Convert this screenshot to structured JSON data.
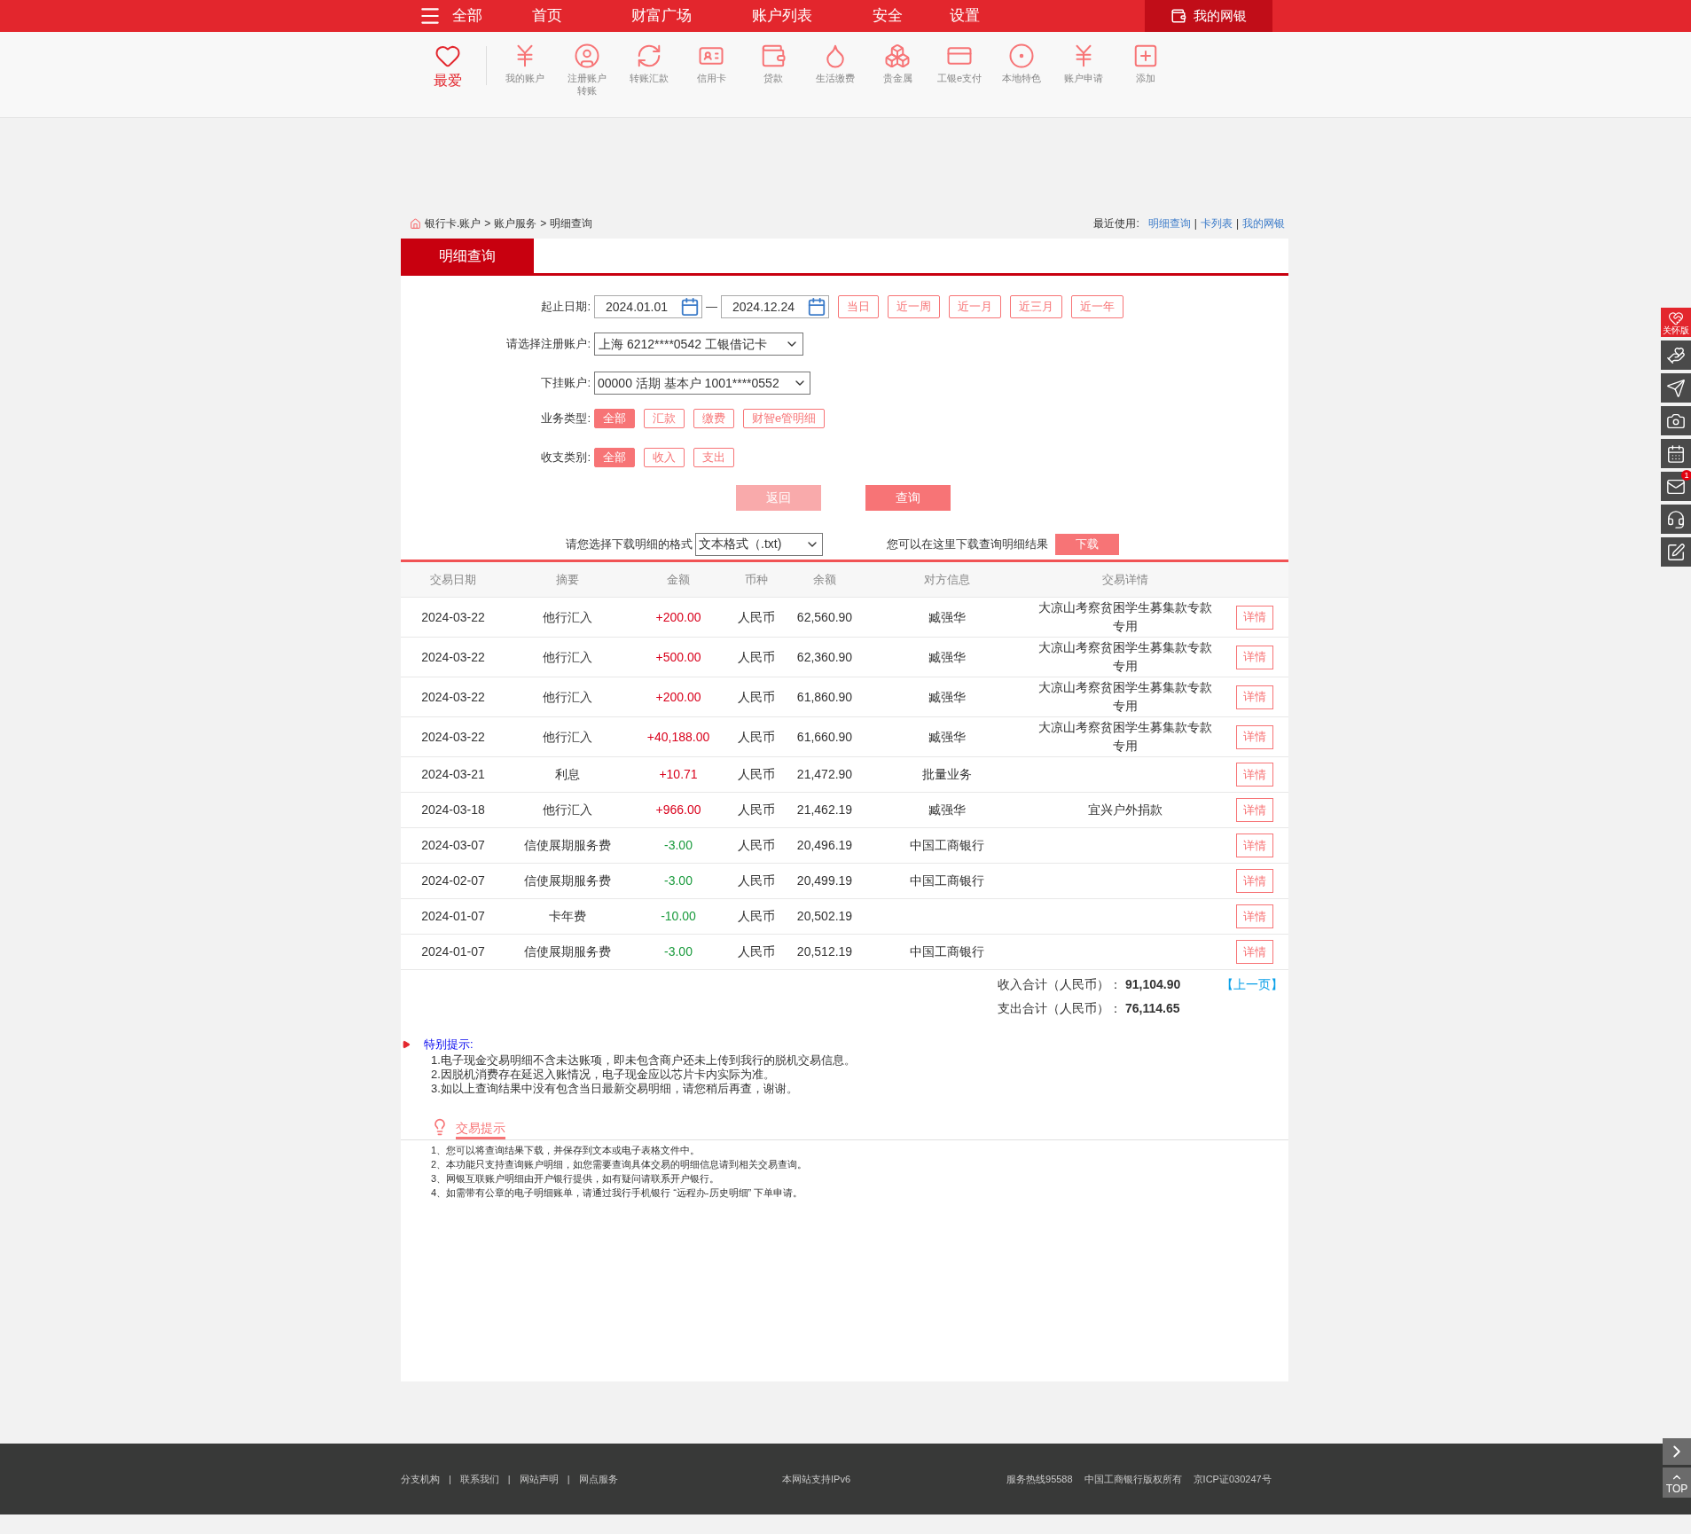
{
  "nav": {
    "menu_label": "全部",
    "items": [
      "首页",
      "财富广场",
      "账户列表",
      "安全",
      "设置"
    ],
    "my_bank": "我的网银"
  },
  "quick_links": [
    {
      "kind": "favorite",
      "label": "最爱",
      "selected": true
    },
    {
      "kind": "account",
      "label": "我的账户",
      "selected": false
    },
    {
      "kind": "register",
      "label": "注册账户转账",
      "selected": false
    },
    {
      "kind": "transfer",
      "label": "转账汇款",
      "selected": false
    },
    {
      "kind": "credit",
      "label": "信用卡",
      "selected": false
    },
    {
      "kind": "loan",
      "label": "贷款",
      "selected": false
    },
    {
      "kind": "utility",
      "label": "生活缴费",
      "selected": false
    },
    {
      "kind": "gold",
      "label": "贵金属",
      "selected": false
    },
    {
      "kind": "epay",
      "label": "工银e支付",
      "selected": false
    },
    {
      "kind": "local",
      "label": "本地特色",
      "selected": false
    },
    {
      "kind": "apply",
      "label": "账户申请",
      "selected": false
    },
    {
      "kind": "add",
      "label": "添加",
      "selected": false
    }
  ],
  "breadcrumb": {
    "items": [
      "银行卡.账户",
      "账户服务",
      "明细查询"
    ],
    "separator": ">"
  },
  "recent": {
    "label": "最近使用:",
    "links": [
      "明细查询",
      "卡列表",
      "我的网银"
    ],
    "separator": "|"
  },
  "tab": "明细查询",
  "form": {
    "date_label": "起止日期:",
    "start_date": "2024.01.01",
    "date_separator": "—",
    "end_date": "2024.12.24",
    "ranges": [
      "当日",
      "近一周",
      "近一月",
      "近三月",
      "近一年"
    ],
    "account_label": "请选择注册账户:",
    "account": "上海 6212****0542 工银借记卡",
    "sub_account_label": "下挂账户:",
    "sub_account": "00000 活期 基本户 1001****0552",
    "business_label": "业务类型:",
    "business_types": [
      {
        "label": "全部",
        "selected": true
      },
      {
        "label": "汇款",
        "selected": false
      },
      {
        "label": "缴费",
        "selected": false
      },
      {
        "label": "财智e管明细",
        "selected": false
      }
    ],
    "flow_label": "收支类别:",
    "flow_types": [
      {
        "label": "全部",
        "selected": true
      },
      {
        "label": "收入",
        "selected": false
      },
      {
        "label": "支出",
        "selected": false
      }
    ],
    "back_button": {
      "label": "返回",
      "disabled": true
    },
    "query_button": "查询"
  },
  "download": {
    "label": "请您选择下载明细的格式",
    "format": "文本格式（.txt)",
    "hint": "您可以在这里下载查询明细结果",
    "button": "下载"
  },
  "table": {
    "columns": [
      "交易日期",
      "摘要",
      "金额",
      "币种",
      "余额",
      "对方信息",
      "交易详情"
    ],
    "rows": [
      {
        "date": "2024-03-22",
        "summary": "他行汇入",
        "amount": "+200.00",
        "kind": "credit",
        "currency": "人民币",
        "balance": "62,560.90",
        "party": "臧强华",
        "detail": "大凉山考察贫困学生募集款专款专用",
        "action": "详情"
      },
      {
        "date": "2024-03-22",
        "summary": "他行汇入",
        "amount": "+500.00",
        "kind": "credit",
        "currency": "人民币",
        "balance": "62,360.90",
        "party": "臧强华",
        "detail": "大凉山考察贫困学生募集款专款专用",
        "action": "详情"
      },
      {
        "date": "2024-03-22",
        "summary": "他行汇入",
        "amount": "+200.00",
        "kind": "credit",
        "currency": "人民币",
        "balance": "61,860.90",
        "party": "臧强华",
        "detail": "大凉山考察贫困学生募集款专款专用",
        "action": "详情"
      },
      {
        "date": "2024-03-22",
        "summary": "他行汇入",
        "amount": "+40,188.00",
        "kind": "credit",
        "currency": "人民币",
        "balance": "61,660.90",
        "party": "臧强华",
        "detail": "大凉山考察贫困学生募集款专款专用",
        "action": "详情"
      },
      {
        "date": "2024-03-21",
        "summary": "利息",
        "amount": "+10.71",
        "kind": "credit",
        "currency": "人民币",
        "balance": "21,472.90",
        "party": "批量业务",
        "action": "详情"
      },
      {
        "date": "2024-03-18",
        "summary": "他行汇入",
        "amount": "+966.00",
        "kind": "credit",
        "currency": "人民币",
        "balance": "21,462.19",
        "party": "臧强华",
        "detail": "宜兴户外捐款",
        "action": "详情"
      },
      {
        "date": "2024-03-07",
        "summary": "信使展期服务费",
        "amount": "-3.00",
        "kind": "debit",
        "currency": "人民币",
        "balance": "20,496.19",
        "party": "中国工商银行",
        "action": "详情"
      },
      {
        "date": "2024-02-07",
        "summary": "信使展期服务费",
        "amount": "-3.00",
        "kind": "debit",
        "currency": "人民币",
        "balance": "20,499.19",
        "party": "中国工商银行",
        "action": "详情"
      },
      {
        "date": "2024-01-07",
        "summary": "卡年费",
        "amount": "-10.00",
        "kind": "debit",
        "currency": "人民币",
        "balance": "20,502.19",
        "action": "详情"
      },
      {
        "date": "2024-01-07",
        "summary": "信使展期服务费",
        "amount": "-3.00",
        "kind": "debit",
        "currency": "人民币",
        "balance": "20,512.19",
        "party": "中国工商银行",
        "action": "详情"
      }
    ]
  },
  "totals": {
    "income_label": "收入合计（人民币）：",
    "income": "91,104.90",
    "expense_label": "支出合计（人民币）：",
    "expense": "76,114.65",
    "prev_page": "【上一页】"
  },
  "special_notice": {
    "title": "特别提示:",
    "items": [
      "1.电子现金交易明细不含未达账项，即未包含商户还未上传到我行的脱机交易信息。",
      "2.因脱机消费存在延迟入账情况，电子现金应以芯片卡内实际为准。",
      "3.如以上查询结果中没有包含当日最新交易明细，请您稍后再查，谢谢。"
    ]
  },
  "tips": {
    "title": "交易提示",
    "items": [
      "1、您可以将查询结果下载，并保存到文本或电子表格文件中。",
      "2、本功能只支持查询账户明细，如您需要查询具体交易的明细信息请到相关交易查询。",
      "3、网银互联账户明细由开户银行提供，如有疑问请联系开户银行。",
      "4、如需带有公章的电子明细账单，请通过我行手机银行 “远程办-历史明细” 下单申请。"
    ]
  },
  "side_tools": [
    {
      "kind": "care",
      "label": "关怀版"
    },
    {
      "kind": "donate"
    },
    {
      "kind": "send"
    },
    {
      "kind": "camera"
    },
    {
      "kind": "calendar"
    },
    {
      "kind": "mail",
      "badge": "1"
    },
    {
      "kind": "service"
    },
    {
      "kind": "note"
    }
  ],
  "corner": {
    "top_label": "TOP"
  },
  "footer": {
    "links": [
      "分支机构",
      "联系我们",
      "网站声明",
      "网点服务"
    ],
    "separator": "|",
    "ipv6": "本网站支持IPv6",
    "hotline": "服务热线95588",
    "copyright": "中国工商银行版权所有",
    "icp": "京ICP证030247号"
  }
}
